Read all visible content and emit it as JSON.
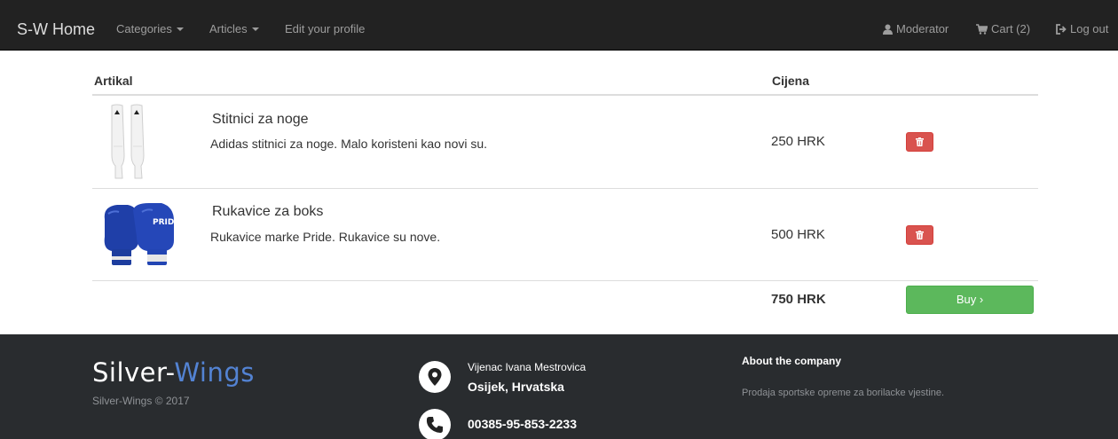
{
  "navbar": {
    "brand": "S-W Home",
    "categories": "Categories",
    "articles": "Articles",
    "edit_profile": "Edit your profile",
    "user": "Moderator",
    "cart": "Cart (2)",
    "logout": "Log out",
    "icons": {
      "user": "user-icon",
      "cart": "cart-icon",
      "logout": "logout-icon"
    }
  },
  "cart_table": {
    "headers": {
      "item": "Artikal",
      "price": "Cijena"
    },
    "rows": [
      {
        "name": "Stitnici za noge",
        "description": "Adidas stitnici za noge. Malo koristeni kao novi su.",
        "price": "250 HRK",
        "image": "shin-guards-image"
      },
      {
        "name": "Rukavice za boks",
        "description": "Rukavice marke Pride. Rukavice su nove.",
        "price": "500 HRK",
        "image": "boxing-gloves-image"
      }
    ],
    "total": "750 HRK",
    "buy_label": "Buy ›"
  },
  "footer": {
    "logo_part1": "Silver-",
    "logo_part2": "Wings",
    "copyright": "Silver-Wings © 2017",
    "address_line1": "Vijenac Ivana Mestrovica",
    "address_line2": "Osijek, Hrvatska",
    "phone": "00385-95-853-2233",
    "about_title": "About the company",
    "about_text": "Prodaja sportske opreme za borilacke vjestine."
  },
  "colors": {
    "navbar_bg": "#222222",
    "footer_bg": "#292c2f",
    "danger": "#d9534f",
    "success": "#5cb85c",
    "logo_accent": "#5383d3"
  }
}
